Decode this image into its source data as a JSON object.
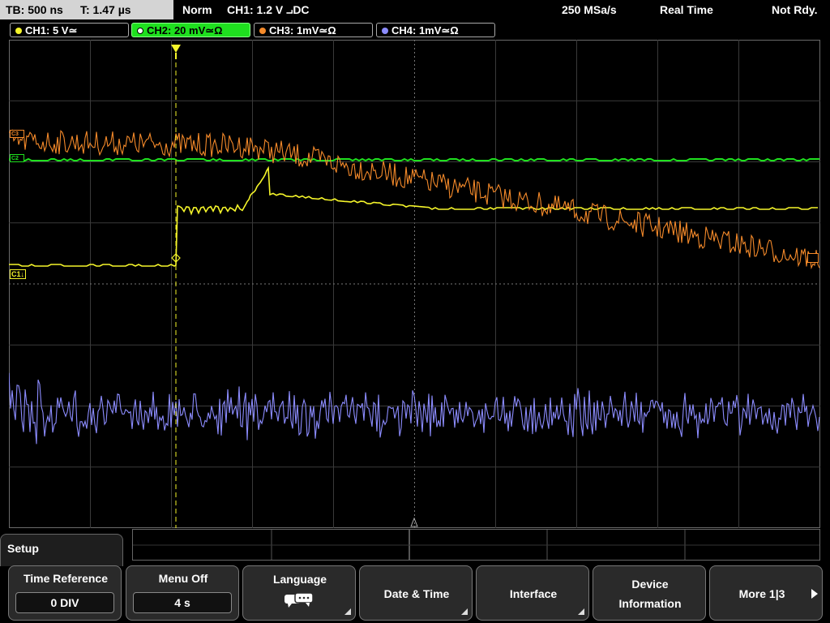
{
  "topbar": {
    "timebase": "TB: 500 ns",
    "trigger_time": "T: 1.47 µs",
    "mode": "Norm",
    "trigger": "CH1: 1.2 V ⨼DC",
    "sample_rate": "250 MSa/s",
    "acq": "Real Time",
    "status": "Not Rdy."
  },
  "channels": [
    {
      "label": "CH1: 5 V≃",
      "color": "#f5f52a"
    },
    {
      "label": "CH2: 20 mV≃Ω",
      "color": "#1fe01f"
    },
    {
      "label": "CH3: 1mV≃Ω",
      "color": "#f58a2a"
    },
    {
      "label": "CH4: 1mV≃Ω",
      "color": "#8c8cff"
    }
  ],
  "markers": {
    "c1": "C1↓",
    "c3": "C3",
    "c2": "C2"
  },
  "menu": {
    "title": "Setup",
    "softkeys": [
      {
        "label": "Time Reference",
        "value": "0 DIV"
      },
      {
        "label": "Menu Off",
        "value": "4 s"
      },
      {
        "label": "Language",
        "icon": "speech-bubbles-icon"
      },
      {
        "label": "Date & Time"
      },
      {
        "label": "Interface"
      },
      {
        "label_line1": "Device",
        "label_line2": "Information"
      },
      {
        "label": "More 1|3"
      }
    ]
  }
}
